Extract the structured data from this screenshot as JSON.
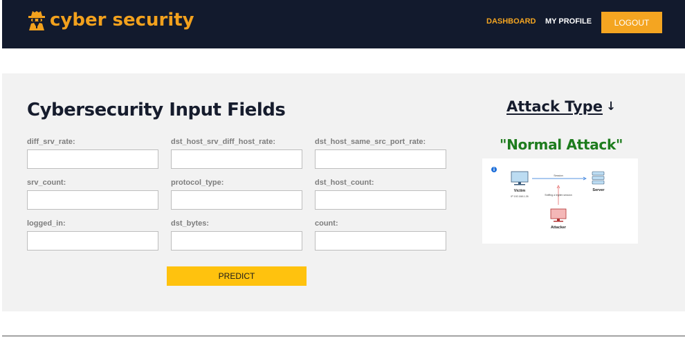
{
  "brand": {
    "name": "cyber security"
  },
  "nav": {
    "dashboard": "DASHBOARD",
    "profile": "MY PROFILE",
    "logout": "LOGOUT"
  },
  "form": {
    "title": "Cybersecurity Input Fields",
    "fields": [
      {
        "label": "diff_srv_rate:",
        "value": ""
      },
      {
        "label": "dst_host_srv_diff_host_rate:",
        "value": ""
      },
      {
        "label": "dst_host_same_src_port_rate:",
        "value": ""
      },
      {
        "label": "srv_count:",
        "value": ""
      },
      {
        "label": "protocol_type:",
        "value": ""
      },
      {
        "label": "dst_host_count:",
        "value": ""
      },
      {
        "label": "logged_in:",
        "value": ""
      },
      {
        "label": "dst_bytes:",
        "value": ""
      },
      {
        "label": "count:",
        "value": ""
      }
    ],
    "predict_label": "PREDICT"
  },
  "result": {
    "heading": "Attack Type",
    "heading_arrow": "↓",
    "value": "\"Normal Attack\""
  },
  "diagram": {
    "victim_label": "Victim",
    "victim_ip": "IP 192.168.1.26",
    "server_label": "Server",
    "session_label": "Session",
    "sniff_label": "Sniffing a legitim session",
    "attacker_label": "Attacker",
    "info_icon": "info-icon"
  },
  "colors": {
    "navbar": "#121a2d",
    "brand": "#f2a11d",
    "logout": "#f4a521",
    "predict": "#ffc20e",
    "result": "#1e7c1e"
  }
}
